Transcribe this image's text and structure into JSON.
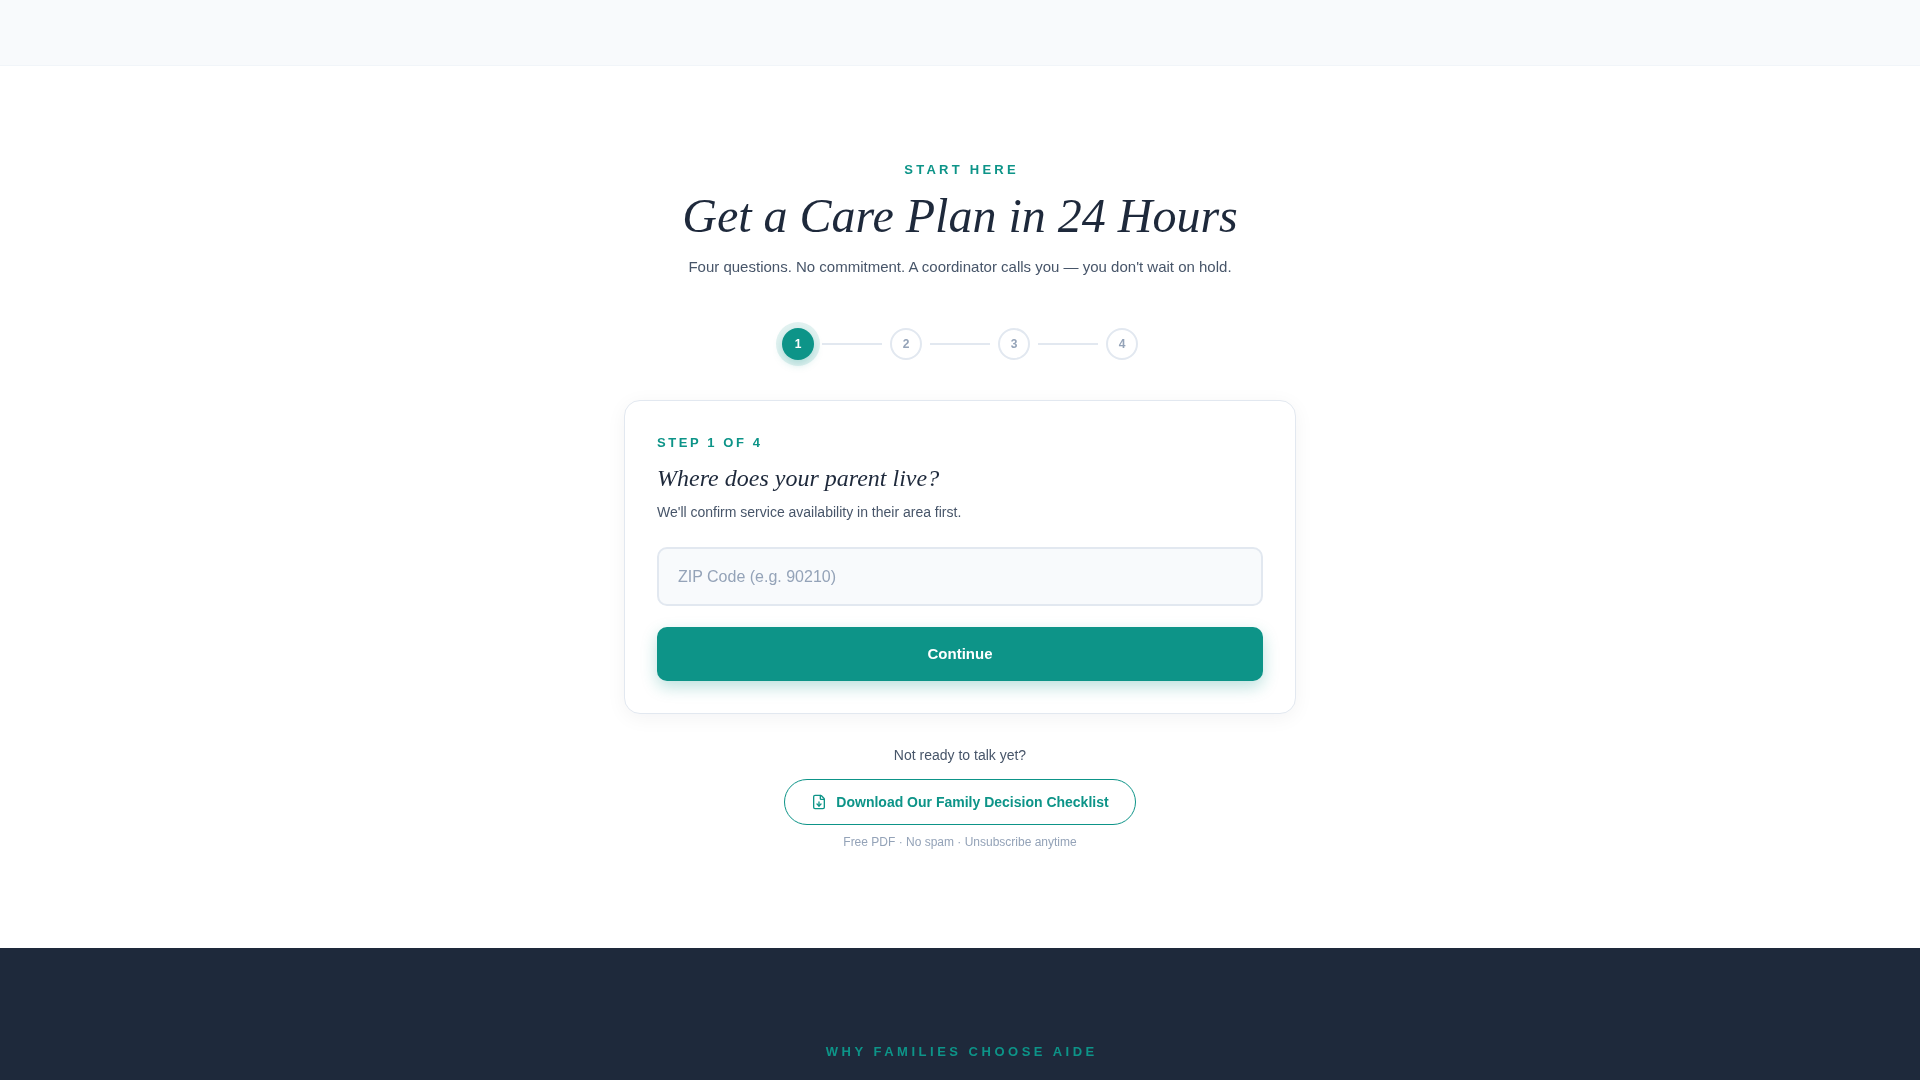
{
  "hero": {
    "eyebrow": "START HERE",
    "title": "Get a Care Plan in 24 Hours",
    "subtitle": "Four questions. No commitment. A coordinator calls you — you don't wait on hold."
  },
  "stepper": {
    "steps": [
      {
        "label": "1",
        "selected": true
      },
      {
        "label": "2",
        "selected": false
      },
      {
        "label": "3",
        "selected": false
      },
      {
        "label": "4",
        "selected": false
      }
    ]
  },
  "form_card": {
    "step_label": "STEP 1 OF 4",
    "question": "Where does your parent live?",
    "description": "We'll confirm service availability in their area first.",
    "zip_field": {
      "placeholder": "ZIP Code (e.g. 90210)"
    },
    "submit_button": "Continue"
  },
  "lead_magnet": {
    "prompt": "Not ready to talk yet?",
    "download_button": "Download Our Family Decision Checklist",
    "fine_print": "Free PDF · No spam · Unsubscribe anytime"
  },
  "features_section": {
    "eyebrow": "WHY FAMILIES CHOOSE AIDE"
  }
}
